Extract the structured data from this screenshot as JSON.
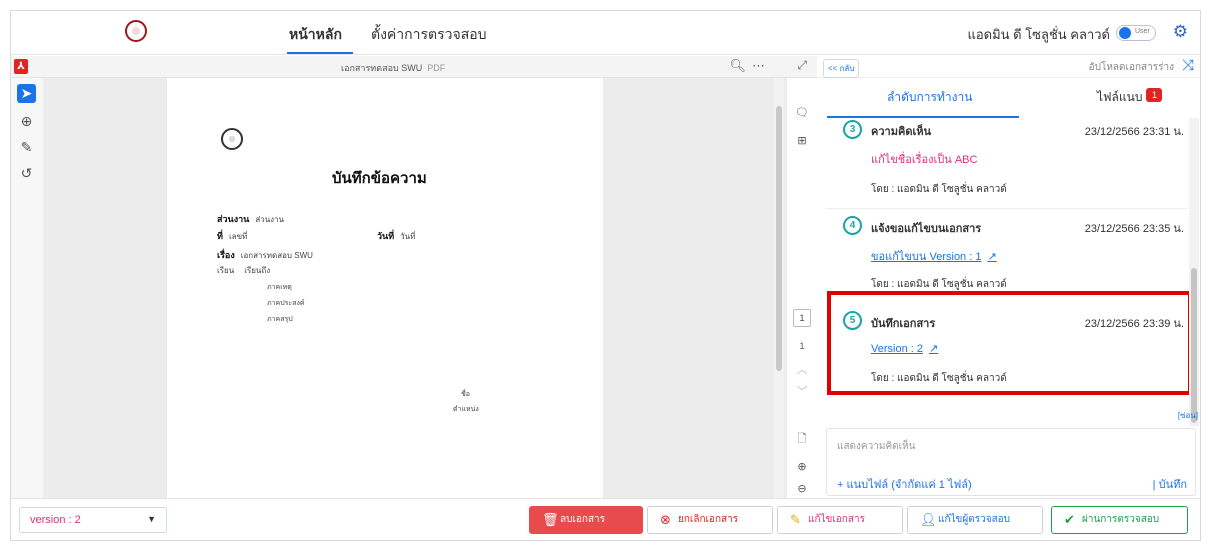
{
  "nav": {
    "tabs": [
      {
        "label": "หน้าหลัก"
      },
      {
        "label": "ตั้งค่าการตรวจสอบ"
      }
    ],
    "user_name": "แอดมิน ดี โซลูชั่น คลาวด์",
    "toggle_label": "User",
    "gear_icon": "gear-icon"
  },
  "pdf": {
    "title": "เอกสารทดสอบ SWU",
    "ext": "PDF",
    "page_number": "1",
    "page_total": "1",
    "content": {
      "heading": "บันทึกข้อความ",
      "row1_key": "ส่วนงาน",
      "row1_val": "ส่วนงาน",
      "row2_key": "ที่",
      "row2_val": "เลขที่",
      "row2_key2": "วันที่",
      "row2_val2": "วันที่",
      "row3_key": "เรื่อง",
      "row3_val": "เอกสารทดสอบ SWU",
      "row4_key": "เรียน",
      "row4_val": "เรียนถึง",
      "p1": "ภาคเหตุ",
      "p2": "ภาคประสงค์",
      "p3": "ภาคสรุป",
      "sign_name": "ชื่อ",
      "sign_pos": "ตำแหน่ง"
    }
  },
  "panel": {
    "back": "<< กลับ",
    "upload": "อัปโหลดเอกสารร่าง",
    "tabs": [
      {
        "label": "ลำดับการทำงาน"
      },
      {
        "label": "ไฟล์แนบ"
      }
    ],
    "attach_count": "1",
    "entries": [
      {
        "num": "3",
        "title": "ความคิดเห็น",
        "time": "23/12/2566 23:31 น.",
        "detail": "แก้ไขชื่อเรื่องเป็น ABC",
        "by": "โดย : แอดมิน ดี โซลูชั่น คลาวด์"
      },
      {
        "num": "4",
        "title": "แจ้งขอแก้ไขบนเอกสาร",
        "time": "23/12/2566 23:35 น.",
        "detail": "ขอแก้ไขบน Version : 1",
        "by": "โดย : แอดมิน ดี โซลูชั่น คลาวด์"
      },
      {
        "num": "5",
        "title": "บันทึกเอกสาร",
        "time": "23/12/2566 23:39 น.",
        "detail": "Version : 2",
        "by": "โดย : แอดมิน ดี โซลูชั่น คลาวด์"
      }
    ],
    "hide": "[ซ่อน]",
    "comment_placeholder": "แสดงความคิดเห็น",
    "attach_label": "+  แนบไฟล์ (จำกัดแค่ 1 ไฟล์)",
    "save_label": "|  บันทึก"
  },
  "bottom": {
    "version": "version : 2",
    "delete": "ลบเอกสาร",
    "cancel": "ยกเลิกเอกสาร",
    "edit": "แก้ไขเอกสาร",
    "reviewer": "แก้ไขผู้ตรวจสอบ",
    "pass": "ผ่านการตรวจสอบ"
  }
}
